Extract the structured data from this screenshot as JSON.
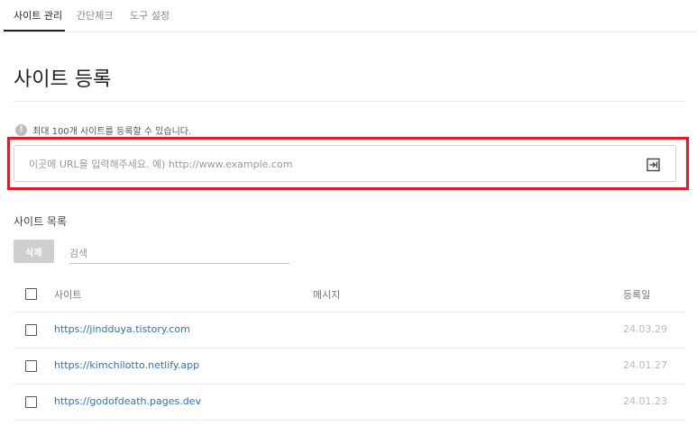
{
  "tabs": [
    {
      "label": "사이트 관리",
      "active": true
    },
    {
      "label": "간단체크",
      "active": false
    },
    {
      "label": "도구 설정",
      "active": false
    }
  ],
  "page_title": "사이트 등록",
  "notice": {
    "icon": "info-icon",
    "text": "최대 100개 사이트를 등록할 수 있습니다."
  },
  "url_input": {
    "placeholder": "이곳에 URL을 입력해주세요. 예) http://www.example.com",
    "value": "",
    "submit_icon": "enter-icon"
  },
  "highlight_color": "#e31c23",
  "site_list": {
    "title": "사이트 목록",
    "delete_label": "삭제",
    "search_placeholder": "검색",
    "columns": {
      "site": "사이트",
      "message": "메시지",
      "date": "등록일"
    },
    "rows": [
      {
        "site": "https://jindduya.tistory.com",
        "message": "",
        "date": "24.03.29"
      },
      {
        "site": "https://kimchilotto.netlify.app",
        "message": "",
        "date": "24.01.27"
      },
      {
        "site": "https://godofdeath.pages.dev",
        "message": "",
        "date": "24.01.23"
      }
    ]
  },
  "colors": {
    "link": "#2f73b5",
    "date": "#bbbbbb",
    "button_disabled": "#cfcfcf"
  }
}
